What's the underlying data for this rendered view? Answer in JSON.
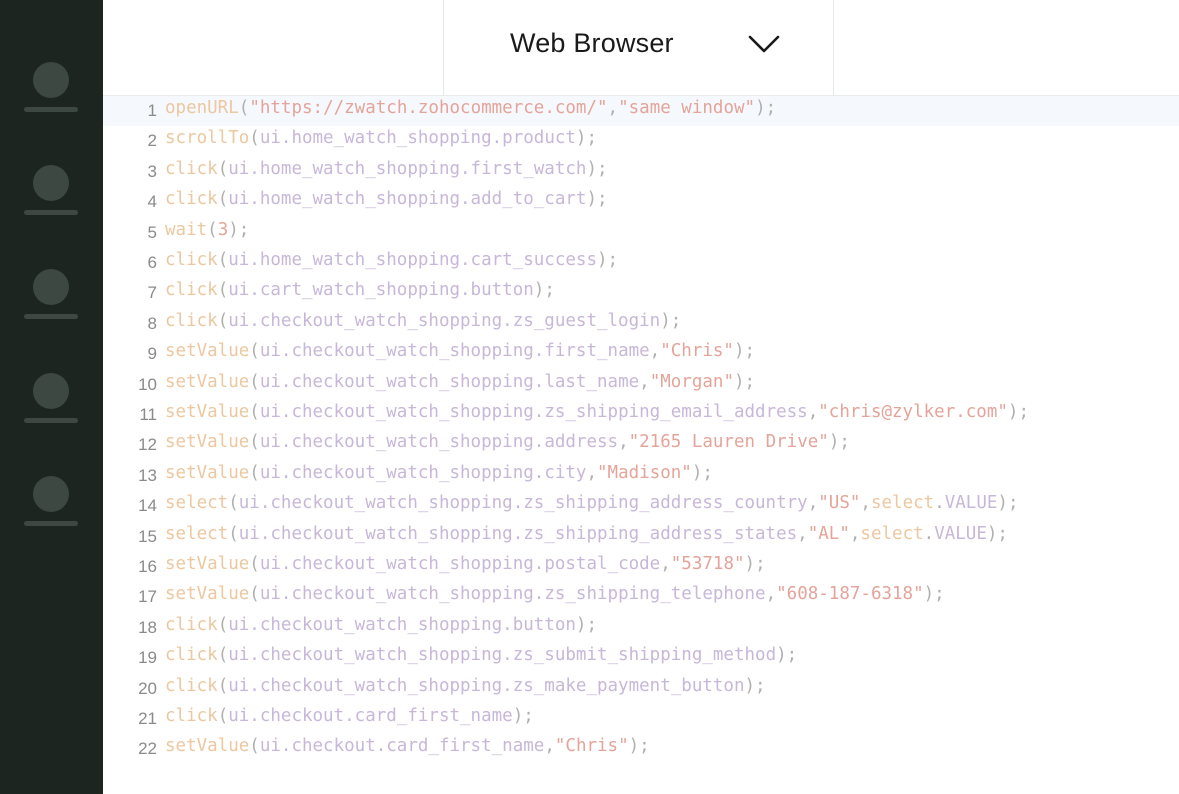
{
  "sidebar": {
    "items": [
      {
        "icon": "user-icon"
      },
      {
        "icon": "user-icon"
      },
      {
        "icon": "user-icon"
      },
      {
        "icon": "user-icon"
      },
      {
        "icon": "user-icon"
      }
    ]
  },
  "header": {
    "dropdown_label": "Web Browser",
    "dropdown_icon": "chevron-down-icon"
  },
  "colors": {
    "sidebar_bg": "#1d2520",
    "function": "#ecc7a0",
    "object": "#c8b7d8",
    "string": "#e4a49a"
  },
  "editor": {
    "lines": [
      {
        "n": "1",
        "tokens": [
          [
            "fn",
            "openURL"
          ],
          [
            "punc",
            "("
          ],
          [
            "str",
            "\"https://zwatch.zohocommerce.com/\""
          ],
          [
            "punc",
            ","
          ],
          [
            "str",
            "\"same window\""
          ],
          [
            "punc",
            ");"
          ]
        ]
      },
      {
        "n": "2",
        "tokens": [
          [
            "fn",
            "scrollTo"
          ],
          [
            "punc",
            "("
          ],
          [
            "obj",
            "ui.home_watch_shopping.product"
          ],
          [
            "punc",
            ");"
          ]
        ]
      },
      {
        "n": "3",
        "tokens": [
          [
            "fn",
            "click"
          ],
          [
            "punc",
            "("
          ],
          [
            "obj",
            "ui.home_watch_shopping.first_watch"
          ],
          [
            "punc",
            ");"
          ]
        ]
      },
      {
        "n": "4",
        "tokens": [
          [
            "fn",
            "click"
          ],
          [
            "punc",
            "("
          ],
          [
            "obj",
            "ui.home_watch_shopping.add_to_cart"
          ],
          [
            "punc",
            ");"
          ]
        ]
      },
      {
        "n": "5",
        "tokens": [
          [
            "fn",
            "wait"
          ],
          [
            "punc",
            "("
          ],
          [
            "num",
            "3"
          ],
          [
            "punc",
            ");"
          ]
        ]
      },
      {
        "n": "6",
        "tokens": [
          [
            "fn",
            "click"
          ],
          [
            "punc",
            "("
          ],
          [
            "obj",
            "ui.home_watch_shopping.cart_success"
          ],
          [
            "punc",
            ");"
          ]
        ]
      },
      {
        "n": "7",
        "tokens": [
          [
            "fn",
            "click"
          ],
          [
            "punc",
            "("
          ],
          [
            "obj",
            "ui.cart_watch_shopping.button"
          ],
          [
            "punc",
            ");"
          ]
        ]
      },
      {
        "n": "8",
        "tokens": [
          [
            "fn",
            "click"
          ],
          [
            "punc",
            "("
          ],
          [
            "obj",
            "ui.checkout_watch_shopping.zs_guest_login"
          ],
          [
            "punc",
            ");"
          ]
        ]
      },
      {
        "n": "9",
        "tokens": [
          [
            "fn",
            "setValue"
          ],
          [
            "punc",
            "("
          ],
          [
            "obj",
            "ui.checkout_watch_shopping.first_name"
          ],
          [
            "punc",
            ","
          ],
          [
            "str",
            "\"Chris\""
          ],
          [
            "punc",
            ");"
          ]
        ]
      },
      {
        "n": "10",
        "tokens": [
          [
            "fn",
            "setValue"
          ],
          [
            "punc",
            "("
          ],
          [
            "obj",
            "ui.checkout_watch_shopping.last_name"
          ],
          [
            "punc",
            ","
          ],
          [
            "str",
            "\"Morgan\""
          ],
          [
            "punc",
            ");"
          ]
        ]
      },
      {
        "n": "11",
        "tokens": [
          [
            "fn",
            "setValue"
          ],
          [
            "punc",
            "("
          ],
          [
            "obj",
            "ui.checkout_watch_shopping.zs_shipping_email_address"
          ],
          [
            "punc",
            ","
          ],
          [
            "str",
            "\"chris@zylker.com\""
          ],
          [
            "punc",
            ");"
          ]
        ]
      },
      {
        "n": "12",
        "tokens": [
          [
            "fn",
            "setValue"
          ],
          [
            "punc",
            "("
          ],
          [
            "obj",
            "ui.checkout_watch_shopping.address"
          ],
          [
            "punc",
            ","
          ],
          [
            "str",
            "\"2165 Lauren Drive\""
          ],
          [
            "punc",
            ");"
          ]
        ]
      },
      {
        "n": "13",
        "tokens": [
          [
            "fn",
            "setValue"
          ],
          [
            "punc",
            "("
          ],
          [
            "obj",
            "ui.checkout_watch_shopping.city"
          ],
          [
            "punc",
            ","
          ],
          [
            "str",
            "\"Madison\""
          ],
          [
            "punc",
            ");"
          ]
        ]
      },
      {
        "n": "14",
        "tokens": [
          [
            "fn",
            "select"
          ],
          [
            "punc",
            "("
          ],
          [
            "obj",
            "ui.checkout_watch_shopping.zs_shipping_address_country"
          ],
          [
            "punc",
            ","
          ],
          [
            "str",
            "\"US\""
          ],
          [
            "punc",
            ","
          ],
          [
            "fn",
            "select"
          ],
          [
            "punc",
            "."
          ],
          [
            "obj",
            "VALUE"
          ],
          [
            "punc",
            ");"
          ]
        ]
      },
      {
        "n": "15",
        "tokens": [
          [
            "fn",
            "select"
          ],
          [
            "punc",
            "("
          ],
          [
            "obj",
            "ui.checkout_watch_shopping.zs_shipping_address_states"
          ],
          [
            "punc",
            ","
          ],
          [
            "str",
            "\"AL\""
          ],
          [
            "punc",
            ","
          ],
          [
            "fn",
            "select"
          ],
          [
            "punc",
            "."
          ],
          [
            "obj",
            "VALUE"
          ],
          [
            "punc",
            ");"
          ]
        ]
      },
      {
        "n": "16",
        "tokens": [
          [
            "fn",
            "setValue"
          ],
          [
            "punc",
            "("
          ],
          [
            "obj",
            "ui.checkout_watch_shopping.postal_code"
          ],
          [
            "punc",
            ","
          ],
          [
            "str",
            "\"53718\""
          ],
          [
            "punc",
            ");"
          ]
        ]
      },
      {
        "n": "17",
        "tokens": [
          [
            "fn",
            "setValue"
          ],
          [
            "punc",
            "("
          ],
          [
            "obj",
            "ui.checkout_watch_shopping.zs_shipping_telephone"
          ],
          [
            "punc",
            ","
          ],
          [
            "str",
            "\"608-187-6318\""
          ],
          [
            "punc",
            ");"
          ]
        ]
      },
      {
        "n": "18",
        "tokens": [
          [
            "fn",
            "click"
          ],
          [
            "punc",
            "("
          ],
          [
            "obj",
            "ui.checkout_watch_shopping.button"
          ],
          [
            "punc",
            ");"
          ]
        ]
      },
      {
        "n": "19",
        "tokens": [
          [
            "fn",
            "click"
          ],
          [
            "punc",
            "("
          ],
          [
            "obj",
            "ui.checkout_watch_shopping.zs_submit_shipping_method"
          ],
          [
            "punc",
            ");"
          ]
        ]
      },
      {
        "n": "20",
        "tokens": [
          [
            "fn",
            "click"
          ],
          [
            "punc",
            "("
          ],
          [
            "obj",
            "ui.checkout_watch_shopping.zs_make_payment_button"
          ],
          [
            "punc",
            ");"
          ]
        ]
      },
      {
        "n": "21",
        "tokens": [
          [
            "fn",
            "click"
          ],
          [
            "punc",
            "("
          ],
          [
            "obj",
            "ui.checkout.card_first_name"
          ],
          [
            "punc",
            ");"
          ]
        ]
      },
      {
        "n": "22",
        "tokens": [
          [
            "fn",
            "setValue"
          ],
          [
            "punc",
            "("
          ],
          [
            "obj",
            "ui.checkout.card_first_name"
          ],
          [
            "punc",
            ","
          ],
          [
            "str",
            "\"Chris\""
          ],
          [
            "punc",
            ");"
          ]
        ]
      }
    ]
  }
}
